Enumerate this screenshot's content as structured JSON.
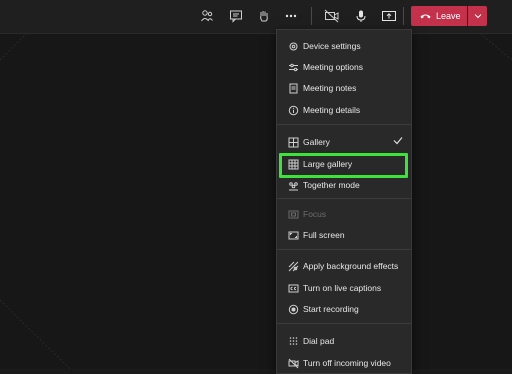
{
  "toolbar": {
    "leave_label": "Leave",
    "accent": "#c4314b",
    "icons": [
      "people-icon",
      "chat-icon",
      "raise-hand-icon",
      "more-actions-icon",
      "camera-off-icon",
      "mic-icon",
      "share-tray-icon"
    ]
  },
  "menu": {
    "items": [
      {
        "label": "Device settings",
        "icon": "gear-icon"
      },
      {
        "label": "Meeting options",
        "icon": "sliders-icon"
      },
      {
        "label": "Meeting notes",
        "icon": "notes-icon"
      },
      {
        "label": "Meeting details",
        "icon": "info-icon"
      },
      {
        "label": "Gallery",
        "icon": "gallery-icon",
        "checked": true
      },
      {
        "label": "Large gallery",
        "icon": "large-gallery-icon",
        "highlighted": true
      },
      {
        "label": "Together mode",
        "icon": "together-mode-icon"
      },
      {
        "label": "Focus",
        "icon": "focus-icon",
        "disabled": true
      },
      {
        "label": "Full screen",
        "icon": "fullscreen-icon"
      },
      {
        "label": "Apply background effects",
        "icon": "background-effects-icon"
      },
      {
        "label": "Turn on live captions",
        "icon": "captions-icon"
      },
      {
        "label": "Start recording",
        "icon": "record-icon"
      },
      {
        "label": "Dial pad",
        "icon": "dialpad-icon"
      },
      {
        "label": "Turn off incoming video",
        "icon": "video-off-icon"
      }
    ]
  },
  "highlight_color": "#3de23d"
}
